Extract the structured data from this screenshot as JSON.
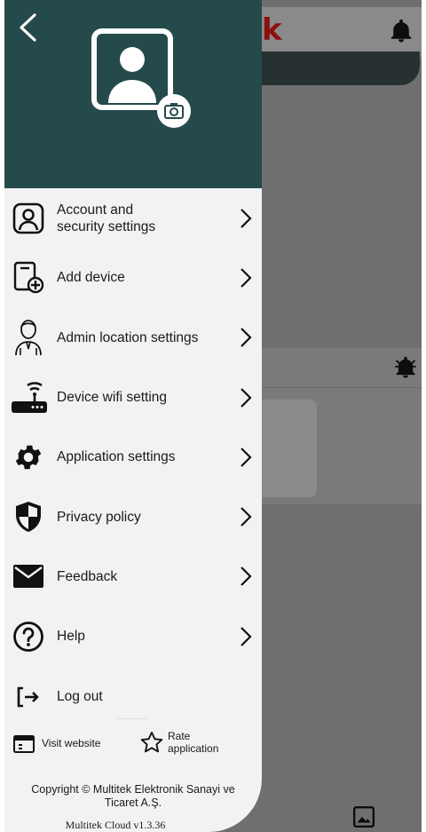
{
  "background_app": {
    "logo_fragment": "k"
  },
  "drawer": {
    "menu": [
      {
        "label": "Account and security settings",
        "icon": "account-icon"
      },
      {
        "label": "Add device",
        "icon": "add-device-icon"
      },
      {
        "label": "Admin location settings",
        "icon": "admin-icon"
      },
      {
        "label": "Device wifi setting",
        "icon": "router-wifi-icon"
      },
      {
        "label": "Application settings",
        "icon": "gear-icon"
      },
      {
        "label": "Privacy policy",
        "icon": "shield-icon"
      },
      {
        "label": "Feedback",
        "icon": "mail-icon"
      },
      {
        "label": "Help",
        "icon": "help-icon"
      }
    ],
    "logout_label": "Log out",
    "visit_website_label": "Visit website",
    "rate_application_label": "Rate application",
    "copyright": "Copyright © Multitek  Elektronik Sanayi ve Ticaret A.Ş.",
    "version": "Multitek Cloud v1.3.36"
  },
  "colors": {
    "drawer_header": "#254a4c",
    "drawer_background": "#f2f2f2",
    "overlay": "#6f6f6f",
    "logo_red": "#8c0f0f"
  }
}
